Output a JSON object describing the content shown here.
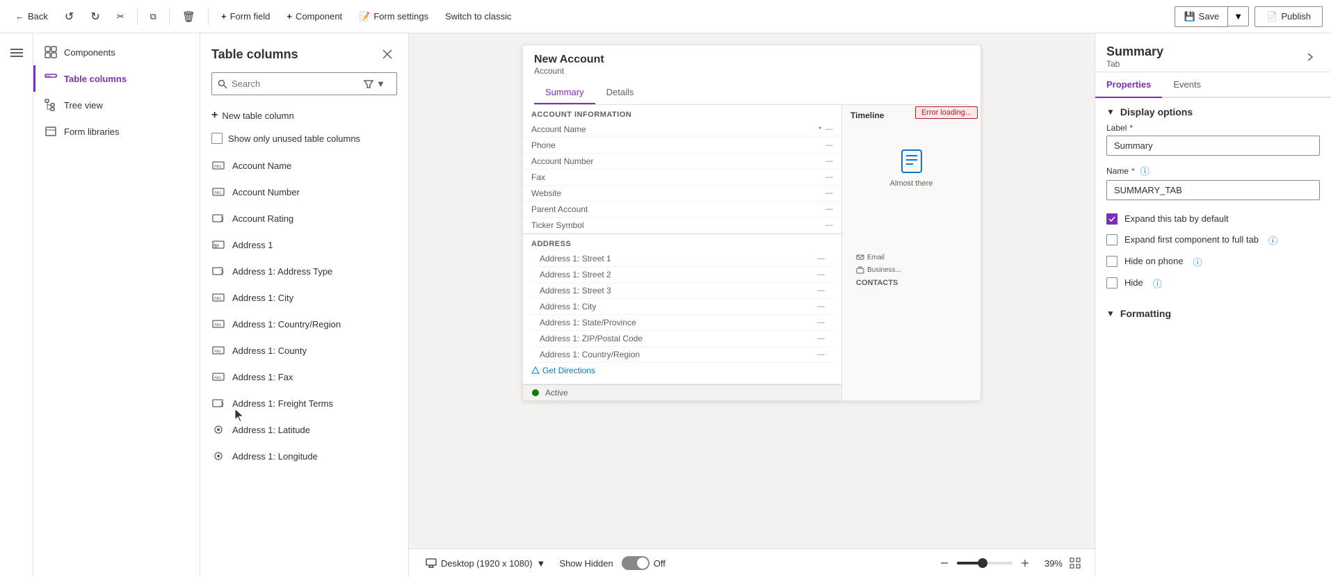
{
  "toolbar": {
    "back_label": "Back",
    "form_field_label": "Form field",
    "component_label": "Component",
    "form_settings_label": "Form settings",
    "switch_classic_label": "Switch to classic",
    "save_label": "Save",
    "publish_label": "Publish"
  },
  "sidebar_nav": {
    "menu_icon": "☰"
  },
  "left_panel": {
    "items": [
      {
        "id": "components",
        "label": "Components",
        "icon": "grid"
      },
      {
        "id": "table-columns",
        "label": "Table columns",
        "icon": "abc",
        "active": true
      },
      {
        "id": "tree-view",
        "label": "Tree view",
        "icon": "tree"
      },
      {
        "id": "form-libraries",
        "label": "Form libraries",
        "icon": "lib"
      }
    ]
  },
  "table_columns_panel": {
    "title": "Table columns",
    "search_placeholder": "Search",
    "new_column_label": "New table column",
    "show_unused_label": "Show only unused table columns",
    "columns": [
      {
        "id": "account-name",
        "label": "Account Name",
        "type": "text"
      },
      {
        "id": "account-number",
        "label": "Account Number",
        "type": "text"
      },
      {
        "id": "account-rating",
        "label": "Account Rating",
        "type": "select"
      },
      {
        "id": "address-1",
        "label": "Address 1",
        "type": "text"
      },
      {
        "id": "address-1-type",
        "label": "Address 1: Address Type",
        "type": "select"
      },
      {
        "id": "address-1-city",
        "label": "Address 1: City",
        "type": "text"
      },
      {
        "id": "address-1-country",
        "label": "Address 1: Country/Region",
        "type": "text"
      },
      {
        "id": "address-1-county",
        "label": "Address 1: County",
        "type": "text"
      },
      {
        "id": "address-1-fax",
        "label": "Address 1: Fax",
        "type": "text"
      },
      {
        "id": "address-1-freight",
        "label": "Address 1: Freight Terms",
        "type": "select"
      },
      {
        "id": "address-1-latitude",
        "label": "Address 1: Latitude",
        "type": "geo"
      },
      {
        "id": "address-1-longitude",
        "label": "Address 1: Longitude",
        "type": "geo"
      }
    ]
  },
  "canvas": {
    "form": {
      "new_account": "New Account",
      "entity": "Account",
      "tabs": [
        {
          "label": "Summary",
          "active": true
        },
        {
          "label": "Details",
          "active": false
        }
      ],
      "sections": {
        "account_info_header": "ACCOUNT INFORMATION",
        "fields": [
          {
            "label": "Account Name",
            "value": "—",
            "required": true
          },
          {
            "label": "Phone",
            "value": "—"
          },
          {
            "label": "Account Number",
            "value": "—"
          },
          {
            "label": "Fax",
            "value": "—"
          },
          {
            "label": "Website",
            "value": "—"
          },
          {
            "label": "Parent Account",
            "value": "—"
          },
          {
            "label": "Ticker Symbol",
            "value": "—"
          }
        ],
        "timeline_header": "Timeline",
        "timeline_icon": "📋",
        "timeline_msg": "Almost there",
        "address_header": "ADDRESS",
        "address_fields": [
          {
            "label": "Address 1: Street 1",
            "value": "—"
          },
          {
            "label": "Address 1: Street 2",
            "value": "—"
          },
          {
            "label": "Address 1: Street 3",
            "value": "—"
          },
          {
            "label": "Address 1: City",
            "value": "—"
          },
          {
            "label": "Address 1: State/Province",
            "value": "—"
          },
          {
            "label": "Address 1: ZIP/Postal Code",
            "value": "—"
          },
          {
            "label": "Address 1: Country/Region",
            "value": "—"
          }
        ],
        "get_directions": "Get Directions",
        "status": "Active"
      },
      "error_loading": "Error loading..."
    },
    "bottom_bar": {
      "desktop_label": "Desktop (1920 x 1080)",
      "show_hidden_label": "Show Hidden",
      "toggle_state": "Off",
      "zoom_percent": "39%"
    }
  },
  "right_panel": {
    "title": "Summary",
    "subtitle": "Tab",
    "tabs": [
      {
        "label": "Properties",
        "active": true
      },
      {
        "label": "Events",
        "active": false
      }
    ],
    "display_options": {
      "section_label": "Display options",
      "label_field_label": "Label",
      "label_value": "Summary",
      "name_field_label": "Name",
      "name_value": "SUMMARY_TAB",
      "expand_tab_label": "Expand this tab by default",
      "expand_tab_checked": true,
      "expand_full_label": "Expand first component to full tab",
      "expand_full_checked": false,
      "hide_phone_label": "Hide on phone",
      "hide_phone_checked": false,
      "hide_label": "Hide",
      "hide_checked": false
    },
    "formatting": {
      "section_label": "Formatting"
    }
  }
}
